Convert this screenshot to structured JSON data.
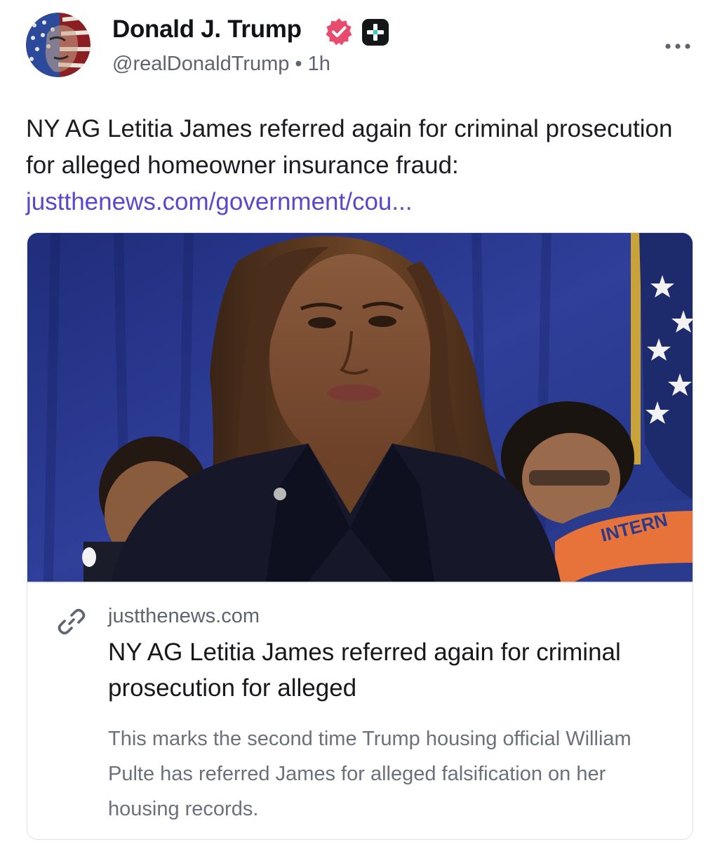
{
  "author": {
    "display_name": "Donald J. Trump",
    "handle": "@realDonaldTrump",
    "separator": "•",
    "time_ago": "1h",
    "verified_badge_icon": "verified-badge-icon",
    "plus_badge_icon": "plus-badge-icon",
    "verified_color": "#e74c6f"
  },
  "post": {
    "text": "NY AG Letitia James referred again for criminal prosecution for alleged homeowner insurance fraud:",
    "link_text": "justthenews.com/government/cou...",
    "link_color": "#5c46ce"
  },
  "card": {
    "image_alt": "Photo of NY Attorney General Letitia James",
    "domain": "justthenews.com",
    "title": "NY AG Letitia James referred again for criminal prosecution for alleged",
    "description": "This marks the second time Trump housing official William Pulte has referred James for alleged falsification on her housing records.",
    "image_flag_text": "INTERN",
    "link_icon": "link-icon"
  },
  "menu": {
    "more_icon": "more-options-icon"
  }
}
